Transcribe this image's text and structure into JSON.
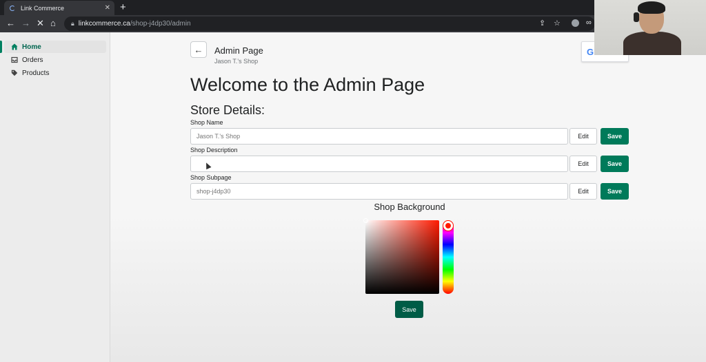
{
  "browser": {
    "tab_title": "Link Commerce",
    "url_host": "linkcommerce.ca",
    "url_path": "/shop-j4dp30/admin"
  },
  "sidebar": {
    "items": [
      {
        "label": "Home",
        "icon": "home-icon",
        "active": true
      },
      {
        "label": "Orders",
        "icon": "inbox-icon",
        "active": false
      },
      {
        "label": "Products",
        "icon": "tag-icon",
        "active": false
      }
    ]
  },
  "header": {
    "title": "Admin Page",
    "subtitle": "Jason T.'s Shop"
  },
  "main": {
    "welcome": "Welcome to the Admin Page",
    "store_details": "Store Details:",
    "fields": [
      {
        "label": "Shop Name",
        "placeholder": "Jason T.'s Shop",
        "edit": "Edit",
        "save": "Save"
      },
      {
        "label": "Shop Description",
        "placeholder": "",
        "edit": "Edit",
        "save": "Save"
      },
      {
        "label": "Shop Subpage",
        "placeholder": "shop-j4dp30",
        "edit": "Edit",
        "save": "Save"
      }
    ],
    "background_label": "Shop Background",
    "background_save": "Save",
    "selected_color": "#ff1a00"
  },
  "colors": {
    "accent": "#008060",
    "save_button": "#007a5a"
  }
}
